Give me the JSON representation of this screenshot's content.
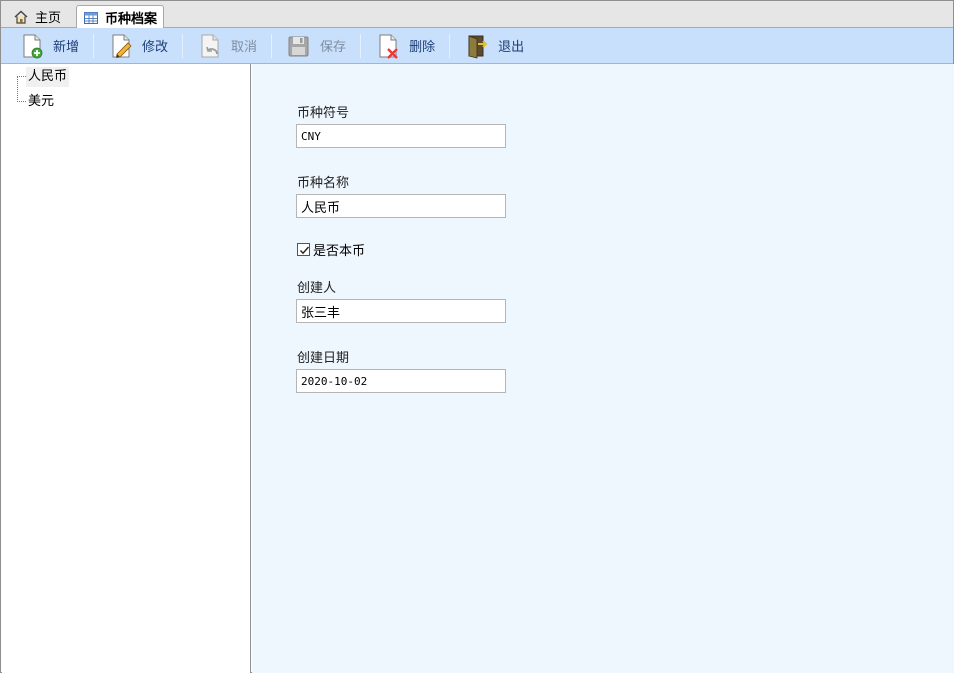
{
  "tabs": {
    "home_label": "主页",
    "active_label": "币种档案"
  },
  "toolbar": {
    "new_label": "新增",
    "edit_label": "修改",
    "cancel_label": "取消",
    "save_label": "保存",
    "delete_label": "删除",
    "exit_label": "退出"
  },
  "tree": {
    "items": [
      {
        "label": "人民币",
        "selected": true
      },
      {
        "label": "美元",
        "selected": false
      }
    ]
  },
  "form": {
    "symbol_label": "币种符号",
    "symbol_value": "CNY",
    "name_label": "币种名称",
    "name_value": "人民币",
    "is_base_label": "是否本币",
    "is_base_checked": true,
    "creator_label": "创建人",
    "creator_value": "张三丰",
    "created_date_label": "创建日期",
    "created_date_value": "2020-10-02"
  }
}
